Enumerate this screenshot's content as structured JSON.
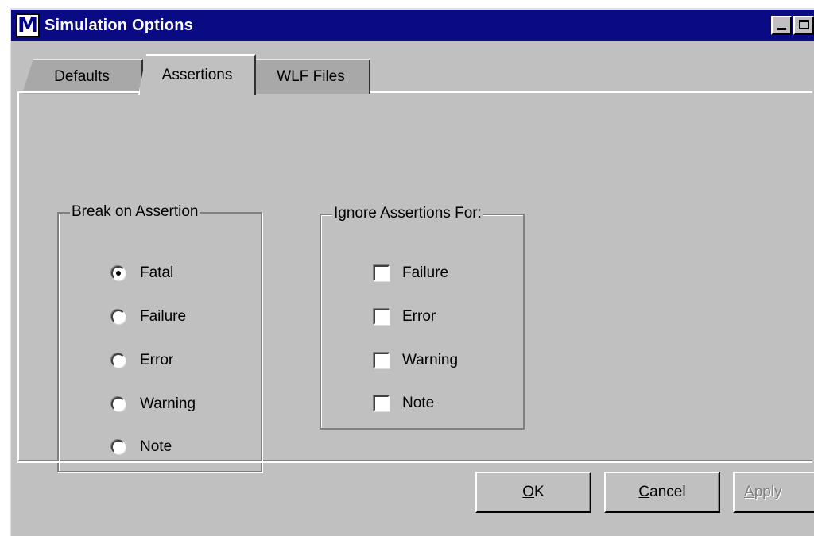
{
  "window": {
    "title": "Simulation Options",
    "app_icon_letter": "M"
  },
  "tabs": [
    {
      "label": "Defaults",
      "active": false
    },
    {
      "label": "Assertions",
      "active": true
    },
    {
      "label": "WLF Files",
      "active": false
    }
  ],
  "break_on_assertion": {
    "legend": "Break on Assertion",
    "options": [
      {
        "label": "Fatal",
        "checked": true
      },
      {
        "label": "Failure",
        "checked": false
      },
      {
        "label": "Error",
        "checked": false
      },
      {
        "label": "Warning",
        "checked": false
      },
      {
        "label": "Note",
        "checked": false
      }
    ]
  },
  "ignore_assertions": {
    "legend": "Ignore Assertions For:",
    "options": [
      {
        "label": "Failure",
        "checked": false
      },
      {
        "label": "Error",
        "checked": false
      },
      {
        "label": "Warning",
        "checked": false
      },
      {
        "label": "Note",
        "checked": false
      }
    ]
  },
  "buttons": {
    "ok": {
      "mnemonic": "O",
      "rest": "K"
    },
    "cancel": {
      "mnemonic": "C",
      "rest": "ancel"
    },
    "apply": {
      "mnemonic": "A",
      "rest": "pply"
    }
  },
  "colors": {
    "titlebar": "#0a0a84",
    "face": "#c0c0c0"
  }
}
